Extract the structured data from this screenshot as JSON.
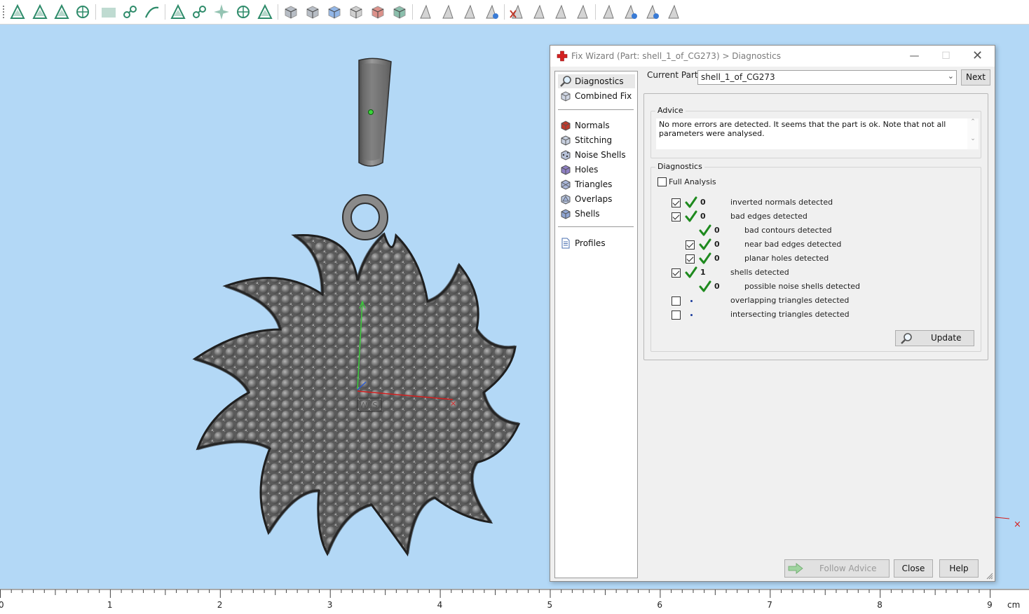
{
  "toolbar": {
    "buttons": [
      "select-triangle-icon",
      "select-surface-icon",
      "select-curve-icon",
      "select-shell-icon",
      "select-plane-icon",
      "select-connected-icon",
      "select-edge-icon",
      "select-flood-icon",
      "select-shell-region-icon",
      "select-all-icon",
      "select-sphere-icon",
      "select-brush-icon",
      "view-front-icon",
      "view-top-icon",
      "view-iso-icon",
      "view-wire-icon",
      "view-render-icon",
      "view-solid-icon",
      "mark-icon",
      "mark-plane-icon",
      "mark-surface-icon",
      "mark-shell-icon",
      "unmark-icon",
      "mark-invert-icon",
      "mark-expand-icon",
      "mark-shrink-icon",
      "measure-icon",
      "measure-angle-icon",
      "measure-radius-icon",
      "measure-clear-icon"
    ]
  },
  "viewport": {
    "background": "#b3d8f6",
    "wcs_label": "WCS"
  },
  "ruler": {
    "labels": [
      "0",
      "1",
      "2",
      "3",
      "4",
      "5",
      "6",
      "7",
      "8",
      "9"
    ],
    "unit": "cm"
  },
  "dialog": {
    "title": "Fix Wizard (Part: shell_1_of_CG273) > Diagnostics",
    "title_icon": "red-cross-icon",
    "window_buttons": [
      "minimize-icon",
      "maximize-icon",
      "close-icon"
    ],
    "nav": {
      "top_items": [
        {
          "label": "Diagnostics",
          "icon": "magnifier-icon",
          "active": true
        },
        {
          "label": "Combined Fix",
          "icon": "combined-fix-icon",
          "active": false
        }
      ],
      "fix_items": [
        {
          "label": "Normals",
          "icon": "normals-icon"
        },
        {
          "label": "Stitching",
          "icon": "stitching-icon"
        },
        {
          "label": "Noise Shells",
          "icon": "noise-shells-icon"
        },
        {
          "label": "Holes",
          "icon": "holes-icon"
        },
        {
          "label": "Triangles",
          "icon": "triangles-icon"
        },
        {
          "label": "Overlaps",
          "icon": "overlaps-icon"
        },
        {
          "label": "Shells",
          "icon": "shells-icon"
        }
      ],
      "profiles": {
        "label": "Profiles",
        "icon": "profiles-icon"
      }
    },
    "current_part_label": "Current Part:",
    "current_part_value": "shell_1_of_CG273",
    "next_button": "Next",
    "advice": {
      "title": "Advice",
      "text": "No more errors are detected. It seems that the part is ok. Note that not all parameters were analysed."
    },
    "diagnostics": {
      "title": "Diagnostics",
      "full_analysis_label": "Full Analysis",
      "full_analysis_checked": false,
      "rows": [
        {
          "checked": true,
          "has_checkbox": true,
          "status": "ok",
          "count": "0",
          "label": "inverted normals detected",
          "indent": 0
        },
        {
          "checked": true,
          "has_checkbox": true,
          "status": "ok",
          "count": "0",
          "label": "bad edges detected",
          "indent": 0
        },
        {
          "checked": false,
          "has_checkbox": false,
          "status": "ok",
          "count": "0",
          "label": "bad contours detected",
          "indent": 1
        },
        {
          "checked": true,
          "has_checkbox": true,
          "status": "ok",
          "count": "0",
          "label": "near bad edges detected",
          "indent": 1
        },
        {
          "checked": true,
          "has_checkbox": true,
          "status": "ok",
          "count": "0",
          "label": "planar holes detected",
          "indent": 1
        },
        {
          "checked": true,
          "has_checkbox": true,
          "status": "ok",
          "count": "1",
          "label": "shells detected",
          "indent": 0
        },
        {
          "checked": false,
          "has_checkbox": false,
          "status": "ok",
          "count": "0",
          "label": "possible noise shells detected",
          "indent": 1
        },
        {
          "checked": false,
          "has_checkbox": true,
          "status": "none",
          "count": "",
          "label": "overlapping triangles detected",
          "indent": 0
        },
        {
          "checked": false,
          "has_checkbox": true,
          "status": "none",
          "count": "",
          "label": "intersecting triangles detected",
          "indent": 0
        }
      ],
      "update_button": "Update"
    },
    "footer": {
      "follow_advice": "Follow Advice",
      "close": "Close",
      "help": "Help"
    },
    "colors": {
      "ok_tick": "#1e8a1e",
      "accent_red": "#d42020"
    }
  }
}
